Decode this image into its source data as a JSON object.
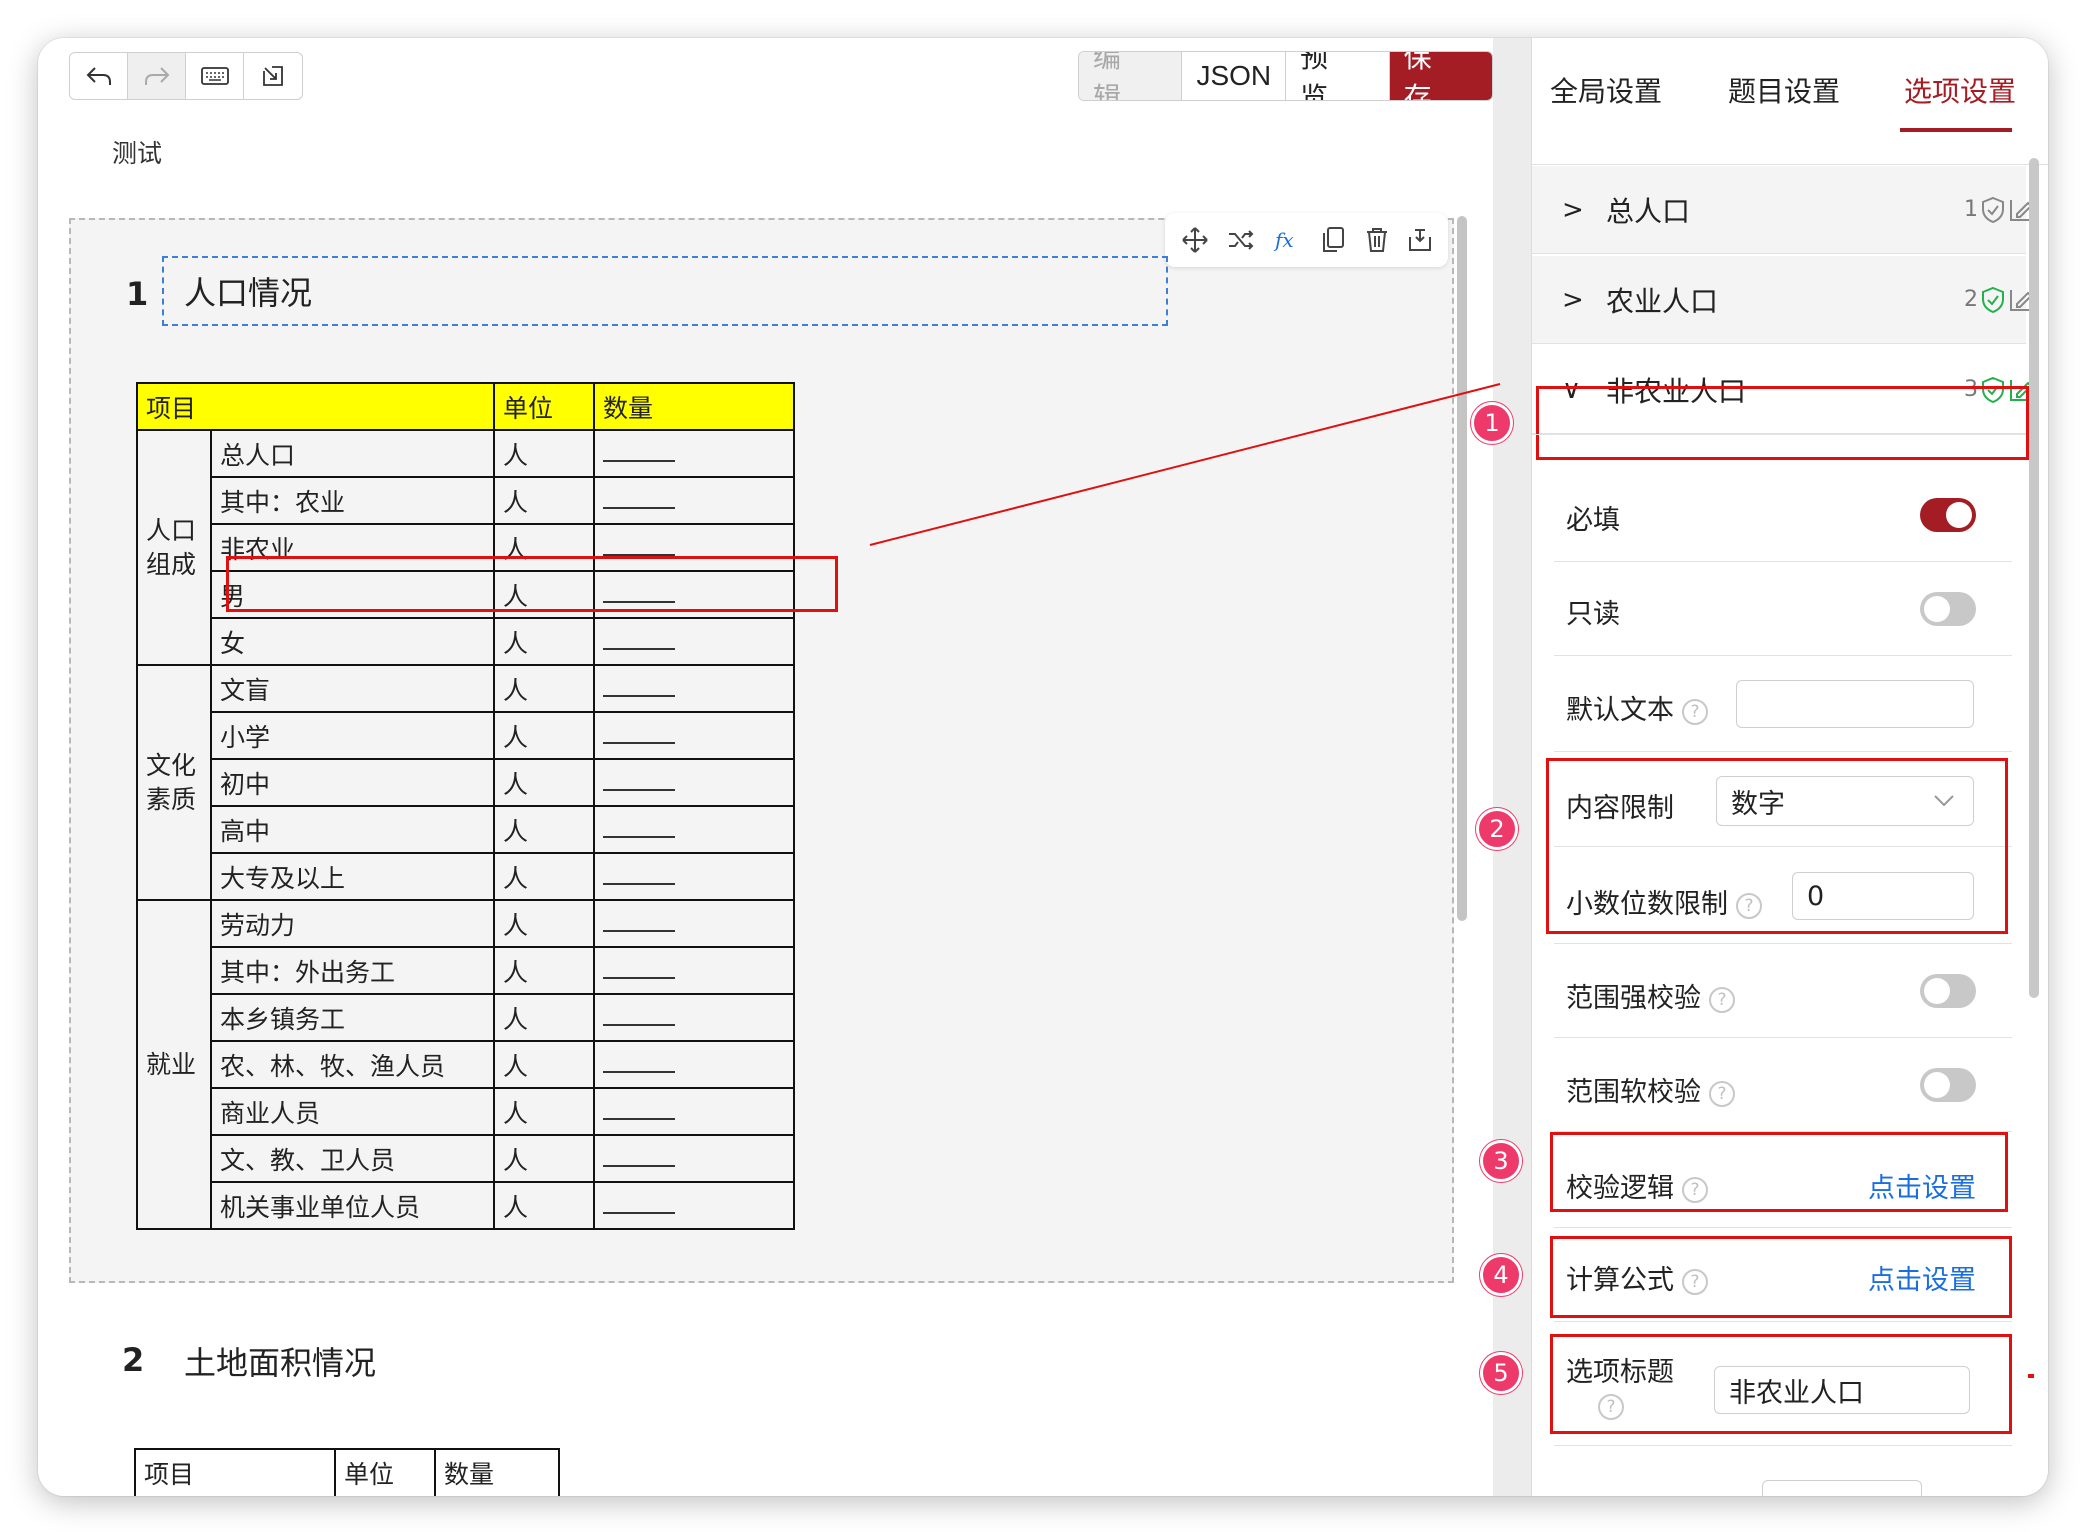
{
  "toolbar": {
    "mode_edit": "编 辑",
    "mode_json": "JSON",
    "mode_preview": "预 览",
    "mode_save": "保 存"
  },
  "document": {
    "title": "测试"
  },
  "question1": {
    "number": "1",
    "title": "人口情况",
    "table": {
      "headers": [
        "项目",
        "单位",
        "数量"
      ],
      "groups": [
        {
          "label": "人口组成",
          "rows": [
            "总人口",
            "其中：农业",
            "非农业",
            "男",
            "女"
          ]
        },
        {
          "label": "文化素质",
          "rows": [
            "文盲",
            "小学",
            "初中",
            "高中",
            "大专及以上"
          ]
        },
        {
          "label": "就业",
          "rows": [
            "劳动力",
            "其中：外出务工",
            "本乡镇务工",
            "农、林、牧、渔人员",
            "商业人员",
            "文、教、卫人员",
            "机关事业单位人员"
          ]
        }
      ],
      "unit": "人",
      "blank": "_____"
    }
  },
  "question2": {
    "number": "2",
    "title": "土地面积情况",
    "headers": [
      "项目",
      "单位",
      "数量"
    ]
  },
  "panel": {
    "tabs": [
      "全局设置",
      "题目设置",
      "选项设置"
    ],
    "active_tab": "选项设置",
    "options": [
      {
        "chevron": ">",
        "label": "总人口",
        "index": "1",
        "verified": false
      },
      {
        "chevron": ">",
        "label": "农业人口",
        "index": "2",
        "verified": true
      },
      {
        "chevron": "∨",
        "label": "非农业人口",
        "index": "3",
        "verified": true
      }
    ],
    "settings": {
      "required_label": "必填",
      "required": true,
      "readonly_label": "只读",
      "readonly": false,
      "default_text_label": "默认文本",
      "default_text_value": "",
      "content_limit_label": "内容限制",
      "content_limit_value": "数字",
      "decimal_limit_label": "小数位数限制",
      "decimal_limit_value": "0",
      "range_strong_label": "范围强校验",
      "range_strong": false,
      "range_soft_label": "范围软校验",
      "range_soft": false,
      "validation_label": "校验逻辑",
      "validation_link": "点击设置",
      "formula_label": "计算公式",
      "formula_link": "点击设置",
      "option_title_label": "选项标题",
      "option_title_value": "非农业人口"
    },
    "callouts": [
      "1",
      "2",
      "3",
      "4",
      "5"
    ],
    "help_glyph": "?"
  },
  "colors": {
    "accent": "#a51d24",
    "highlight": "#e01010",
    "header_yellow": "#ffff00",
    "badge": "#ee3a6a",
    "link": "#1a6ee0",
    "verified": "#22b14c"
  }
}
